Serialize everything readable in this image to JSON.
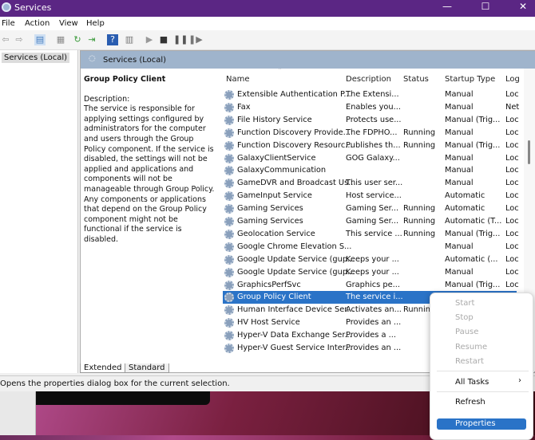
{
  "window": {
    "title": "Services",
    "controls": [
      "—",
      "☐",
      "✕"
    ]
  },
  "menu": [
    "File",
    "Action",
    "View",
    "Help"
  ],
  "tree": {
    "item": "Services (Local)"
  },
  "pane": {
    "header": "Services (Local)"
  },
  "details": {
    "title": "Group Policy Client",
    "label": "Description:",
    "text": "The service is responsible for applying settings configured by administrators for the computer and users through the Group Policy component. If the service is disabled, the settings will not be applied and applications and components will not be manageable through Group Policy. Any components or applications that depend on the Group Policy component might not be functional if the service is disabled."
  },
  "columns": [
    "Name",
    "Description",
    "Status",
    "Startup Type",
    "Log"
  ],
  "rows": [
    [
      "Extensible Authentication P...",
      "The Extensi...",
      "",
      "Manual",
      "Loc"
    ],
    [
      "Fax",
      "Enables you...",
      "",
      "Manual",
      "Net"
    ],
    [
      "File History Service",
      "Protects use...",
      "",
      "Manual (Trig...",
      "Loc"
    ],
    [
      "Function Discovery Provide...",
      "The FDPHO...",
      "Running",
      "Manual",
      "Loc"
    ],
    [
      "Function Discovery Resourc...",
      "Publishes th...",
      "Running",
      "Manual (Trig...",
      "Loc"
    ],
    [
      "GalaxyClientService",
      "GOG Galaxy...",
      "",
      "Manual",
      "Loc"
    ],
    [
      "GalaxyCommunication",
      "",
      "",
      "Manual",
      "Loc"
    ],
    [
      "GameDVR and Broadcast Us...",
      "This user ser...",
      "",
      "Manual",
      "Loc"
    ],
    [
      "GameInput Service",
      "Host service...",
      "",
      "Automatic",
      "Loc"
    ],
    [
      "Gaming Services",
      "Gaming Ser...",
      "Running",
      "Automatic",
      "Loc"
    ],
    [
      "Gaming Services",
      "Gaming Ser...",
      "Running",
      "Automatic (T...",
      "Loc"
    ],
    [
      "Geolocation Service",
      "This service ...",
      "Running",
      "Manual (Trig...",
      "Loc"
    ],
    [
      "Google Chrome Elevation S...",
      "",
      "",
      "Manual",
      "Loc"
    ],
    [
      "Google Update Service (gup...",
      "Keeps your ...",
      "",
      "Automatic (...",
      "Loc"
    ],
    [
      "Google Update Service (gup...",
      "Keeps your ...",
      "",
      "Manual",
      "Loc"
    ],
    [
      "GraphicsPerfSvc",
      "Graphics pe...",
      "",
      "Manual (Trig...",
      "Loc"
    ],
    [
      "Group Policy Client",
      "The service i...",
      "",
      "Automatic (T...",
      "Loc"
    ],
    [
      "Human Interface Device Ser...",
      "Activates an...",
      "Running",
      "",
      ""
    ],
    [
      "HV Host Service",
      "Provides an ...",
      "",
      "",
      ""
    ],
    [
      "Hyper-V Data Exchange Ser...",
      "Provides a ...",
      "",
      "",
      ""
    ],
    [
      "Hyper-V Guest Service Inter...",
      "Provides an ...",
      "",
      "",
      ""
    ]
  ],
  "selected_row": 16,
  "tabs": [
    "Extended",
    "Standard"
  ],
  "status": "Opens the properties dialog box for the current selection.",
  "context_menu": {
    "items": [
      {
        "label": "Start",
        "enabled": false
      },
      {
        "label": "Stop",
        "enabled": false
      },
      {
        "label": "Pause",
        "enabled": false
      },
      {
        "label": "Resume",
        "enabled": false
      },
      {
        "label": "Restart",
        "enabled": false
      },
      {
        "label": "All Tasks",
        "enabled": true,
        "submenu": "›"
      },
      {
        "label": "Refresh",
        "enabled": true
      },
      {
        "label": "Properties",
        "enabled": true,
        "highlighted": true
      }
    ]
  },
  "colors": {
    "titlebar": "#5b2684",
    "selection": "#2a73c7",
    "pane_header": "#9fb4cc"
  }
}
